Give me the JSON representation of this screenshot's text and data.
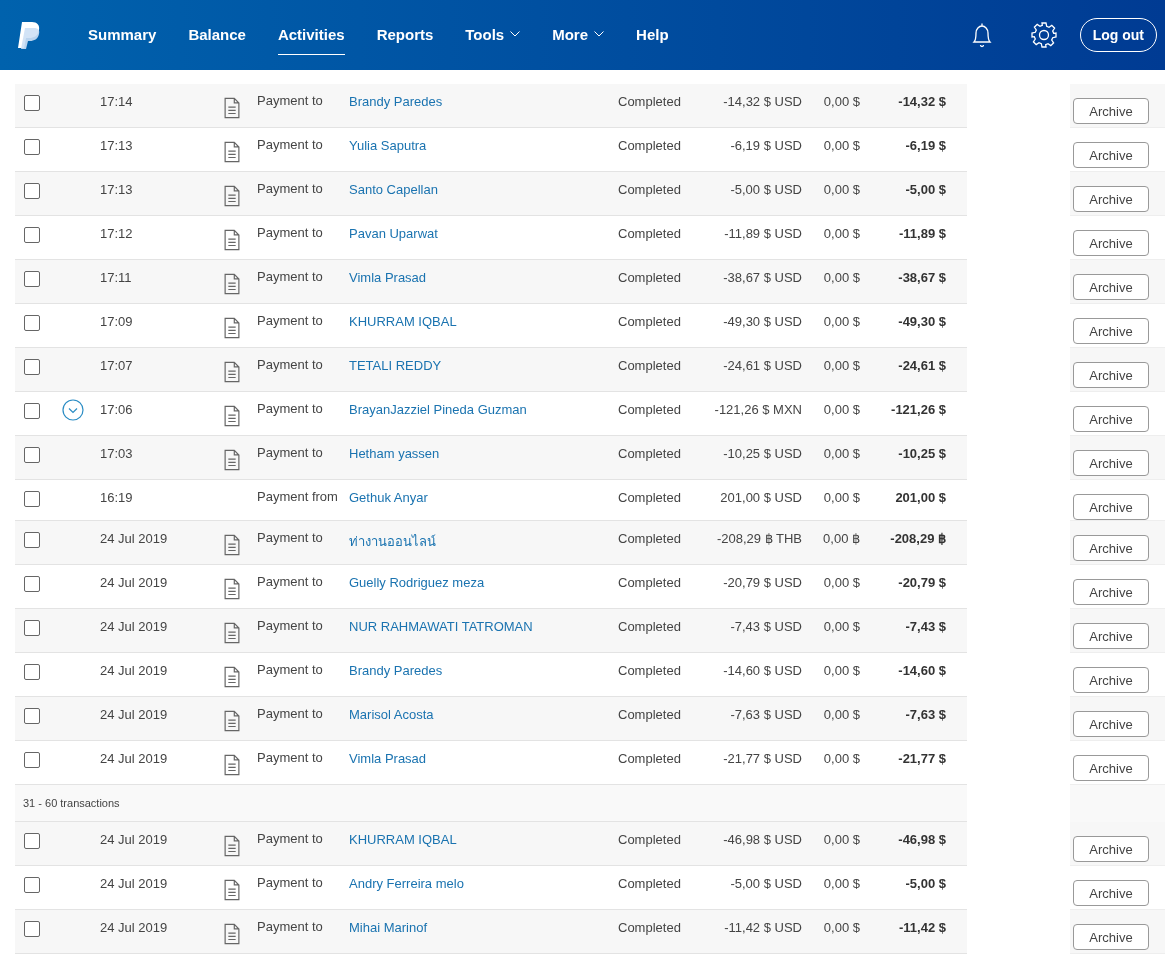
{
  "nav": {
    "items": [
      {
        "label": "Summary",
        "selected": false,
        "dropdown": false
      },
      {
        "label": "Balance",
        "selected": false,
        "dropdown": false
      },
      {
        "label": "Activities",
        "selected": true,
        "dropdown": false
      },
      {
        "label": "Reports",
        "selected": false,
        "dropdown": false
      },
      {
        "label": "Tools",
        "selected": false,
        "dropdown": true
      },
      {
        "label": "More",
        "selected": false,
        "dropdown": true
      },
      {
        "label": "Help",
        "selected": false,
        "dropdown": false
      }
    ],
    "logout": "Log out"
  },
  "groups": [
    {
      "rows": [
        {
          "date": "17:14",
          "checked": false,
          "expandable": false,
          "receipt": true,
          "type": "Payment to",
          "name": "Brandy Paredes",
          "status": "Completed",
          "gross": "-14,32 $ USD",
          "fee": "0,00 $",
          "net": "-14,32 $",
          "action": "Archive"
        },
        {
          "date": "17:13",
          "checked": false,
          "expandable": false,
          "receipt": true,
          "type": "Payment to",
          "name": "Yulia Saputra",
          "status": "Completed",
          "gross": "-6,19 $ USD",
          "fee": "0,00 $",
          "net": "-6,19 $",
          "action": "Archive"
        },
        {
          "date": "17:13",
          "checked": false,
          "expandable": false,
          "receipt": true,
          "type": "Payment to",
          "name": "Santo Capellan",
          "status": "Completed",
          "gross": "-5,00 $ USD",
          "fee": "0,00 $",
          "net": "-5,00 $",
          "action": "Archive"
        },
        {
          "date": "17:12",
          "checked": false,
          "expandable": false,
          "receipt": true,
          "type": "Payment to",
          "name": "Pavan Uparwat",
          "status": "Completed",
          "gross": "-11,89 $ USD",
          "fee": "0,00 $",
          "net": "-11,89 $",
          "action": "Archive"
        },
        {
          "date": "17:11",
          "checked": false,
          "expandable": false,
          "receipt": true,
          "type": "Payment to",
          "name": "Vimla Prasad",
          "status": "Completed",
          "gross": "-38,67 $ USD",
          "fee": "0,00 $",
          "net": "-38,67 $",
          "action": "Archive"
        },
        {
          "date": "17:09",
          "checked": false,
          "expandable": false,
          "receipt": true,
          "type": "Payment to",
          "name": "KHURRAM IQBAL",
          "status": "Completed",
          "gross": "-49,30 $ USD",
          "fee": "0,00 $",
          "net": "-49,30 $",
          "action": "Archive"
        },
        {
          "date": "17:07",
          "checked": false,
          "expandable": false,
          "receipt": true,
          "type": "Payment to",
          "name": "TETALI REDDY",
          "status": "Completed",
          "gross": "-24,61 $ USD",
          "fee": "0,00 $",
          "net": "-24,61 $",
          "action": "Archive"
        },
        {
          "date": "17:06",
          "checked": false,
          "expandable": true,
          "receipt": true,
          "type": "Payment to",
          "name": "BrayanJazziel Pineda Guzman",
          "status": "Completed",
          "gross": "-121,26 $ MXN",
          "fee": "0,00 $",
          "net": "-121,26 $",
          "action": "Archive"
        },
        {
          "date": "17:03",
          "checked": false,
          "expandable": false,
          "receipt": true,
          "type": "Payment to",
          "name": "Hetham yassen",
          "status": "Completed",
          "gross": "-10,25 $ USD",
          "fee": "0,00 $",
          "net": "-10,25 $",
          "action": "Archive"
        },
        {
          "date": "16:19",
          "checked": false,
          "expandable": false,
          "receipt": false,
          "type": "Payment from",
          "name": "Gethuk Anyar",
          "status": "Completed",
          "gross": "201,00 $ USD",
          "fee": "0,00 $",
          "net": "201,00 $",
          "action": "Archive"
        },
        {
          "date": "24 Jul 2019",
          "expandable": false,
          "receipt": true,
          "checked": false,
          "type": "Payment to",
          "name": "ท่างานออนไลน์",
          "status": "Completed",
          "gross": "-208,29 ฿ THB",
          "fee": "0,00 ฿",
          "net": "-208,29 ฿",
          "action": "Archive"
        },
        {
          "date": "24 Jul 2019",
          "expandable": false,
          "receipt": true,
          "checked": false,
          "type": "Payment to",
          "name": "Guelly Rodriguez meza",
          "status": "Completed",
          "gross": "-20,79 $ USD",
          "fee": "0,00 $",
          "net": "-20,79 $",
          "action": "Archive"
        },
        {
          "date": "24 Jul 2019",
          "expandable": false,
          "receipt": true,
          "checked": false,
          "type": "Payment to",
          "name": "NUR RAHMAWATI TATROMAN",
          "status": "Completed",
          "gross": "-7,43 $ USD",
          "fee": "0,00 $",
          "net": "-7,43 $",
          "action": "Archive"
        },
        {
          "date": "24 Jul 2019",
          "expandable": false,
          "receipt": true,
          "checked": false,
          "type": "Payment to",
          "name": "Brandy Paredes",
          "status": "Completed",
          "gross": "-14,60 $ USD",
          "fee": "0,00 $",
          "net": "-14,60 $",
          "action": "Archive"
        },
        {
          "date": "24 Jul 2019",
          "expandable": false,
          "receipt": true,
          "checked": false,
          "type": "Payment to",
          "name": "Marisol Acosta",
          "status": "Completed",
          "gross": "-7,63 $ USD",
          "fee": "0,00 $",
          "net": "-7,63 $",
          "action": "Archive"
        },
        {
          "date": "24 Jul 2019",
          "expandable": false,
          "receipt": true,
          "checked": false,
          "type": "Payment to",
          "name": "Vimla Prasad",
          "status": "Completed",
          "gross": "-21,77 $ USD",
          "fee": "0,00 $",
          "net": "-21,77 $",
          "action": "Archive"
        }
      ]
    },
    {
      "heading": "31 - 60 transactions",
      "rows": [
        {
          "date": "24 Jul 2019",
          "expandable": false,
          "receipt": true,
          "checked": false,
          "type": "Payment to",
          "name": "KHURRAM IQBAL",
          "status": "Completed",
          "gross": "-46,98 $ USD",
          "fee": "0,00 $",
          "net": "-46,98 $",
          "action": "Archive"
        },
        {
          "date": "24 Jul 2019",
          "expandable": false,
          "receipt": true,
          "checked": false,
          "type": "Payment to",
          "name": "Andry Ferreira melo",
          "status": "Completed",
          "gross": "-5,00 $ USD",
          "fee": "0,00 $",
          "net": "-5,00 $",
          "action": "Archive"
        },
        {
          "date": "24 Jul 2019",
          "expandable": false,
          "receipt": true,
          "checked": false,
          "type": "Payment to",
          "name": "Mihai Marinof",
          "status": "Completed",
          "gross": "-11,42 $ USD",
          "fee": "0,00 $",
          "net": "-11,42 $",
          "action": "Archive"
        }
      ]
    }
  ]
}
